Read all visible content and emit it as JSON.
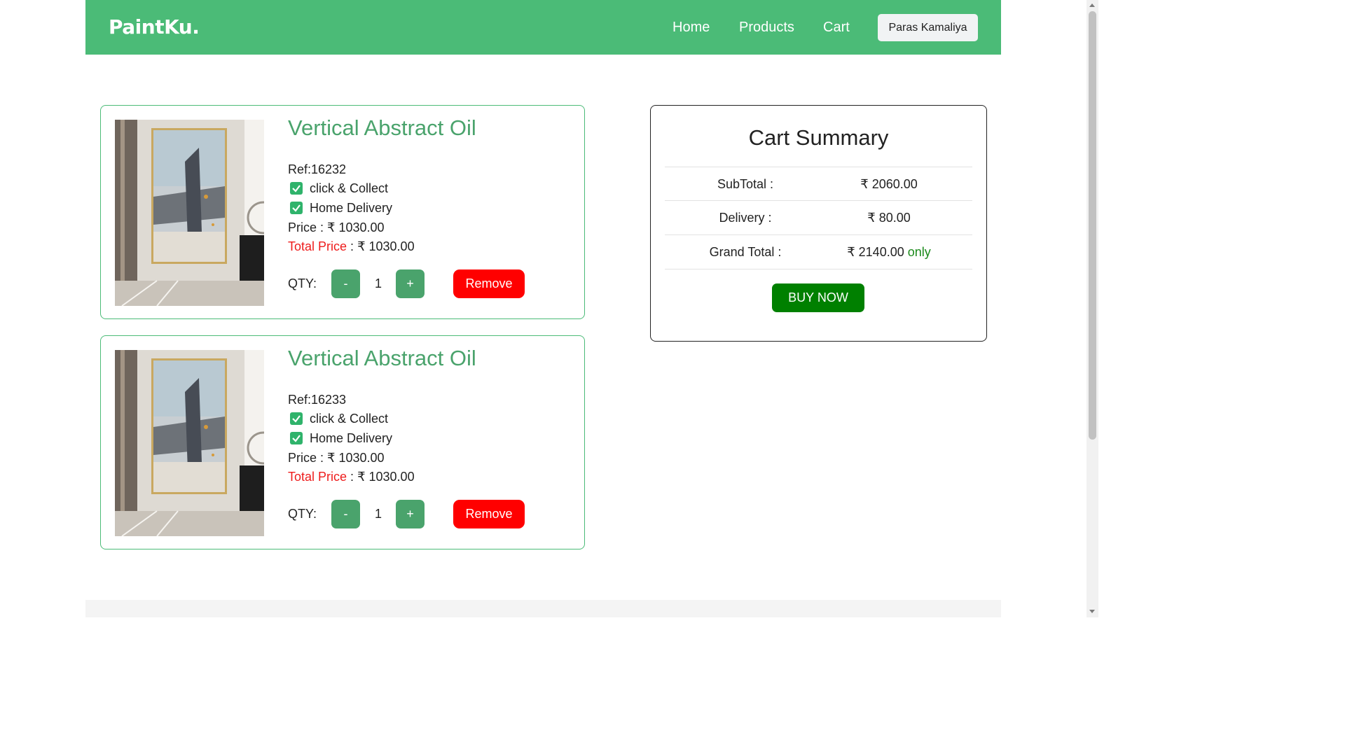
{
  "nav": {
    "brand": "PaintKu.",
    "links": [
      "Home",
      "Products",
      "Cart"
    ],
    "user": "Paras Kamaliya"
  },
  "cart_items": [
    {
      "title": "Vertical Abstract Oil",
      "ref": "Ref:16232",
      "option1": "click & Collect",
      "option2": "Home Delivery",
      "price_label": "Price : ",
      "price": "₹ 1030.00",
      "total_label": "Total Price",
      "total_sep": " : ",
      "total": "₹ 1030.00",
      "qty_label": "QTY:",
      "qty": "1",
      "minus": "-",
      "plus": "+",
      "remove": "Remove"
    },
    {
      "title": "Vertical Abstract Oil",
      "ref": "Ref:16233",
      "option1": "click & Collect",
      "option2": "Home Delivery",
      "price_label": "Price : ",
      "price": "₹ 1030.00",
      "total_label": "Total Price",
      "total_sep": " : ",
      "total": "₹ 1030.00",
      "qty_label": "QTY:",
      "qty": "1",
      "minus": "-",
      "plus": "+",
      "remove": "Remove"
    }
  ],
  "summary": {
    "title": "Cart Summary",
    "subtotal_label": "SubTotal :",
    "subtotal": "₹ 2060.00",
    "delivery_label": "Delivery :",
    "delivery": "₹ 80.00",
    "grand_label": "Grand Total :",
    "grand": "₹ 2140.00",
    "grand_suffix": "only",
    "buy": "BUY NOW"
  },
  "colors": {
    "navbar": "#4bbb77",
    "title_green": "#4aa36c",
    "remove_red": "#ff0000",
    "buy_green": "#008000"
  }
}
